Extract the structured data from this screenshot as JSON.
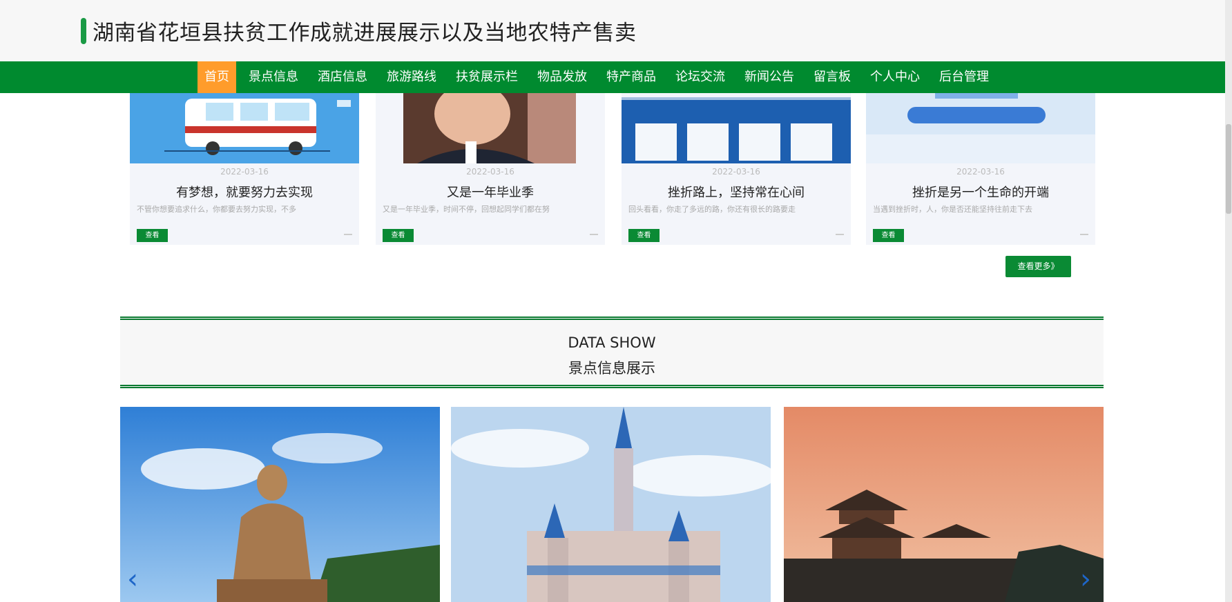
{
  "header": {
    "title": "湖南省花垣县扶贫工作成就进展展示以及当地农特产售卖"
  },
  "nav": {
    "items": [
      {
        "label": "首页",
        "active": true
      },
      {
        "label": "景点信息"
      },
      {
        "label": "酒店信息"
      },
      {
        "label": "旅游路线"
      },
      {
        "label": "扶贫展示栏"
      },
      {
        "label": "物品发放"
      },
      {
        "label": "特产商品"
      },
      {
        "label": "论坛交流"
      },
      {
        "label": "新闻公告"
      },
      {
        "label": "留言板"
      },
      {
        "label": "个人中心"
      },
      {
        "label": "后台管理"
      }
    ]
  },
  "news": {
    "cards": [
      {
        "date": "2022-03-16",
        "title": "有梦想，就要努力去实现",
        "excerpt": "不管你想要追求什么，你都要去努力实现，不多",
        "button": "查看"
      },
      {
        "date": "2022-03-16",
        "title": "又是一年毕业季",
        "excerpt": "又是一年毕业季，时间不停，回想起同学们都在努",
        "button": "查看"
      },
      {
        "date": "2022-03-16",
        "title": "挫折路上，坚持常在心间",
        "excerpt": "回头看看，你走了多远的路，你还有很长的路要走",
        "button": "查看"
      },
      {
        "date": "2022-03-16",
        "title": "挫折是另一个生命的开端",
        "excerpt": "当遇到挫折时，人，你是否还能坚持往前走下去",
        "button": "查看"
      }
    ],
    "view_more": "查看更多》"
  },
  "section": {
    "en": "DATA SHOW",
    "cn": "景点信息展示"
  },
  "gallery": {
    "prev_arrow": "‹",
    "next_arrow": "›"
  },
  "colors": {
    "nav_bg": "#008a2f",
    "nav_active": "#ff9c2b",
    "accent_green": "#0a8a34"
  }
}
